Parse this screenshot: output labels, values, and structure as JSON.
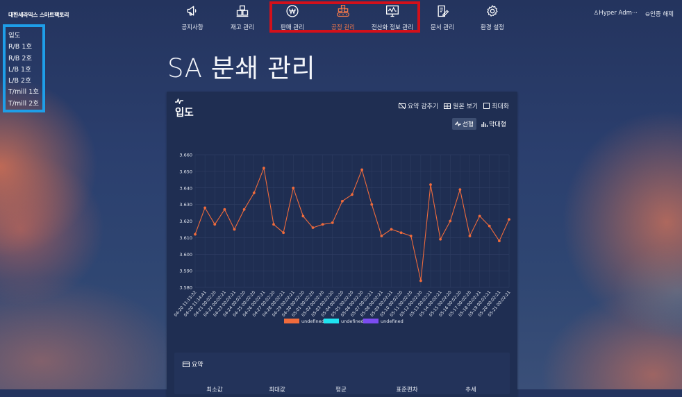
{
  "brand": "대한세라믹스 스마트팩토리",
  "nav": [
    {
      "label": "공지사항",
      "icon": "megaphone-icon",
      "active": false
    },
    {
      "label": "재고 관리",
      "icon": "boxes-icon",
      "active": false
    },
    {
      "label": "판매 관리",
      "icon": "won-icon",
      "active": false
    },
    {
      "label": "공정 관리",
      "icon": "conveyor-icon",
      "active": true
    },
    {
      "label": "전산화 정보 관리",
      "icon": "monitor-chart-icon",
      "active": false
    },
    {
      "label": "문서 관리",
      "icon": "document-edit-icon",
      "active": false
    },
    {
      "label": "환경 설정",
      "icon": "gear-icon",
      "active": false
    }
  ],
  "header": {
    "user": "Hyper Adm···",
    "logout": "인증 해제"
  },
  "sidebar": {
    "items": [
      "입도",
      "R/B 1호",
      "R/B 2호",
      "L/B 1호",
      "L/B 2호",
      "T/mill 1호",
      "T/mill 2호"
    ]
  },
  "page_title": "SA 분쇄 관리",
  "card": {
    "title": "입도",
    "actions": [
      "요약 감추기",
      "원본 보기",
      "최대화"
    ],
    "type_tabs": [
      "선형",
      "막대형"
    ]
  },
  "summary": {
    "title": "요약",
    "headers": [
      "최소값",
      "최대값",
      "평균",
      "표준편차",
      "추세"
    ]
  },
  "colors": {
    "accent": "#f2784b",
    "line": "#f06b3c",
    "highlight_box": "#d3101a",
    "sidebar_box": "#1e9ee8"
  },
  "chart_data": {
    "type": "line",
    "x": [
      "04-20 11:13:32",
      "04-20 11:14:41",
      "04-21 00:02:20",
      "04-22 00:02:21",
      "04-23 00:02:21",
      "04-24 00:02:20",
      "04-25 00:02:20",
      "04-26 00:02:21",
      "04-27 00:02:20",
      "04-28 00:02:21",
      "04-29 00:02:21",
      "04-30 00:02:20",
      "05-01 00:02:20",
      "05-02 00:02:20",
      "05-03 00:02:20",
      "05-04 00:02:20",
      "05-05 00:02:20",
      "05-06 00:02:20",
      "05-07 00:02:21",
      "05-08 00:02:21",
      "05-09 00:02:21",
      "05-10 00:02:20",
      "05-11 00:02:20",
      "05-12 00:02:20",
      "05-13 00:02:21",
      "05-14 00:02:21",
      "05-15 00:02:20",
      "05-16 00:02:20",
      "05-17 00:02:20",
      "05-18 00:02:21",
      "05-19 00:02:21",
      "05-20 00:02:21",
      "05-21 00:02:21"
    ],
    "series": [
      {
        "name": "undefined",
        "color": "#f06b3c",
        "values": [
          3.612,
          3.628,
          3.618,
          3.627,
          3.615,
          3.627,
          3.637,
          3.652,
          3.618,
          3.613,
          3.64,
          3.623,
          3.616,
          3.618,
          3.619,
          3.632,
          3.636,
          3.651,
          3.63,
          3.611,
          3.615,
          3.613,
          3.611,
          3.584,
          3.642,
          3.609,
          3.62,
          3.639,
          3.611,
          3.623,
          3.617,
          3.608,
          3.621
        ]
      },
      {
        "name": "undefined",
        "color": "#1fe3f0",
        "values": []
      },
      {
        "name": "undefined",
        "color": "#7b4cf0",
        "values": []
      }
    ],
    "yticks": [
      "3.660",
      "3.650",
      "3.640",
      "3.630",
      "3.620",
      "3.610",
      "3.600",
      "3.590",
      "3.580"
    ],
    "ylim": [
      3.58,
      3.66
    ],
    "grid": true,
    "legend": "bottom"
  }
}
